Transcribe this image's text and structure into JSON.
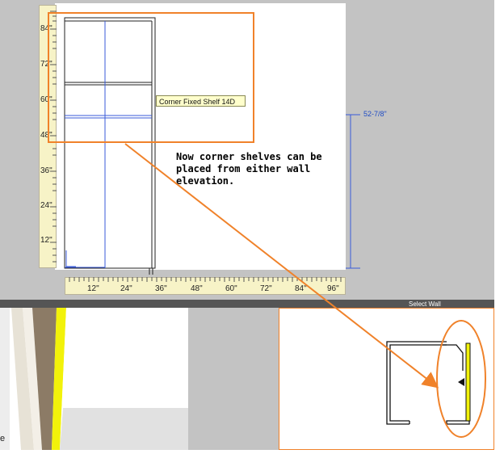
{
  "colors": {
    "canvas_gray": "#c3c3c3",
    "ruler": "#f7f3c7",
    "callout_orange": "#f0822a",
    "dimension_blue": "#1f4cc4",
    "wall_yellow": "#f2f20a",
    "bar_dark": "#555555"
  },
  "elevation": {
    "vertical_ruler_labels": [
      "84\"",
      "72\"",
      "60\"",
      "48\"",
      "36\"",
      "24\"",
      "12\""
    ],
    "horizontal_ruler_labels": [
      "12\"",
      "24\"",
      "36\"",
      "48\"",
      "60\"",
      "72\"",
      "84\"",
      "96\""
    ],
    "tooltip": "Corner Fixed Shelf 14D",
    "dimension": "52-7/8\"",
    "note": "Now corner shelves can be\nplaced from either wall\nelevation."
  },
  "bottom_bar": {
    "label": "Select Wall"
  },
  "left_edge_glyph": "e",
  "icons": {
    "wall_arrow": "triangle-left-icon"
  }
}
